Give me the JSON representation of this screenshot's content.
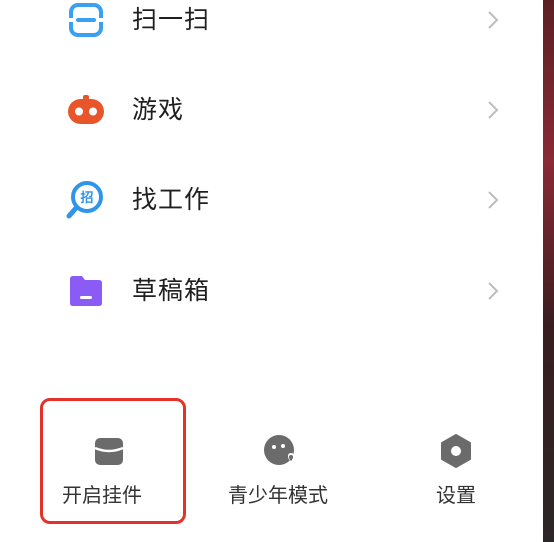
{
  "menu": {
    "items": [
      {
        "label": "扫一扫",
        "icon": "scan-icon",
        "color": "#3aa0f2"
      },
      {
        "label": "游戏",
        "icon": "game-icon",
        "color": "#e8552b"
      },
      {
        "label": "找工作",
        "icon": "job-search-icon",
        "color": "#2f95e8"
      },
      {
        "label": "草稿箱",
        "icon": "drafts-folder-icon",
        "color": "#8a5cf5"
      },
      {
        "label": "",
        "icon": "folder-icon",
        "color": "#f3b13b"
      }
    ]
  },
  "bottom_bar": {
    "widget_label": "开启挂件",
    "teen_mode_label": "青少年模式",
    "settings_label": "设置"
  },
  "colors": {
    "highlight": "#e3322a",
    "icon_gray": "#6b6b6b",
    "chevron": "#bdbdbd"
  }
}
